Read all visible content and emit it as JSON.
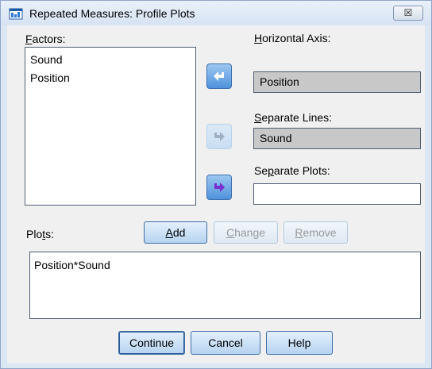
{
  "window": {
    "title": "Repeated Measures: Profile Plots",
    "close_label": "☒"
  },
  "factors": {
    "label_key": "F",
    "label_rest": "actors:",
    "items": [
      "Sound",
      "Position"
    ]
  },
  "horizontal_axis": {
    "label_key": "H",
    "label_rest": "orizontal Axis:",
    "value": "Position"
  },
  "separate_lines": {
    "label_key": "S",
    "label_rest": "eparate Lines:",
    "value": "Sound"
  },
  "separate_plots": {
    "label_pre": "Se",
    "label_key": "p",
    "label_rest": "arate Plots:",
    "value": ""
  },
  "plots": {
    "label_pre": "Plo",
    "label_key": "t",
    "label_rest": "s:",
    "items": [
      "Position*Sound"
    ]
  },
  "buttons": {
    "add_key": "A",
    "add_rest": "dd",
    "change_key": "C",
    "change_rest": "hange",
    "remove_key": "R",
    "remove_rest": "emove",
    "continue": "Continue",
    "cancel": "Cancel",
    "help": "Help"
  },
  "icons": {
    "move_to_horizontal": "arrow-left-icon",
    "move_to_lines": "arrow-right-icon",
    "move_to_plots": "arrow-right-icon"
  },
  "colors": {
    "accent": "#4f92dc",
    "filled_field": "#c8c8c8"
  }
}
